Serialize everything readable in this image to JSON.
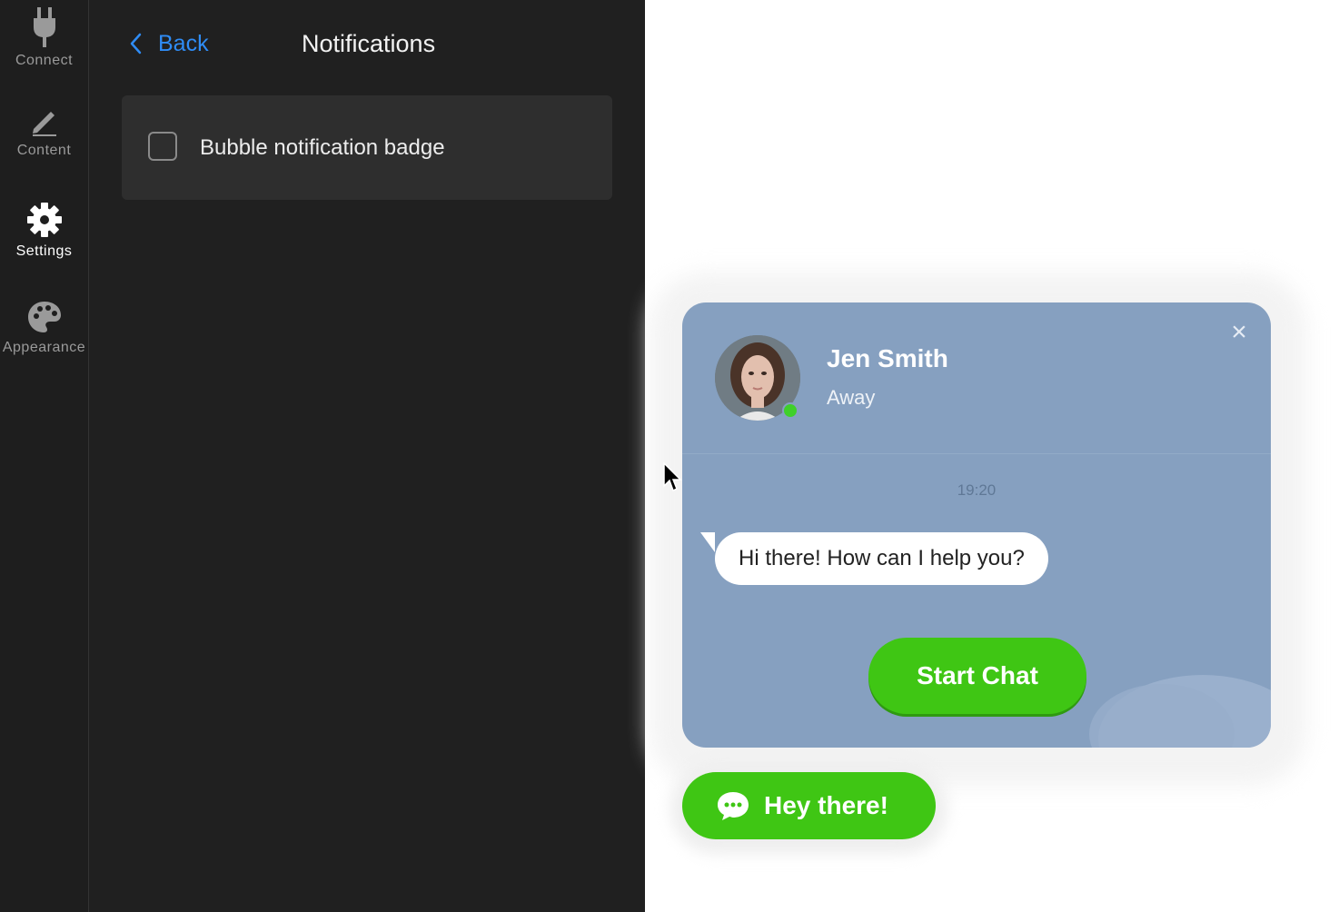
{
  "sidebar": {
    "items": [
      {
        "label": "Connect",
        "icon": "plug-icon"
      },
      {
        "label": "Content",
        "icon": "pencil-icon"
      },
      {
        "label": "Settings",
        "icon": "gear-icon",
        "active": true
      },
      {
        "label": "Appearance",
        "icon": "palette-icon"
      }
    ]
  },
  "header": {
    "back_label": "Back",
    "title": "Notifications"
  },
  "options": [
    {
      "label": "Bubble notification badge",
      "checked": false
    }
  ],
  "widget": {
    "agent_name": "Jen Smith",
    "agent_status": "Away",
    "timestamp": "19:20",
    "message": "Hi there! How can I help you?",
    "start_chat_label": "Start Chat",
    "online": true
  },
  "launcher": {
    "label": "Hey there!",
    "icon": "chat-bubble-icon"
  },
  "colors": {
    "accent_blue": "#2f8cf5",
    "brand_green": "#3fc614",
    "widget_bg": "#86a0c0",
    "panel_bg": "#202020"
  }
}
